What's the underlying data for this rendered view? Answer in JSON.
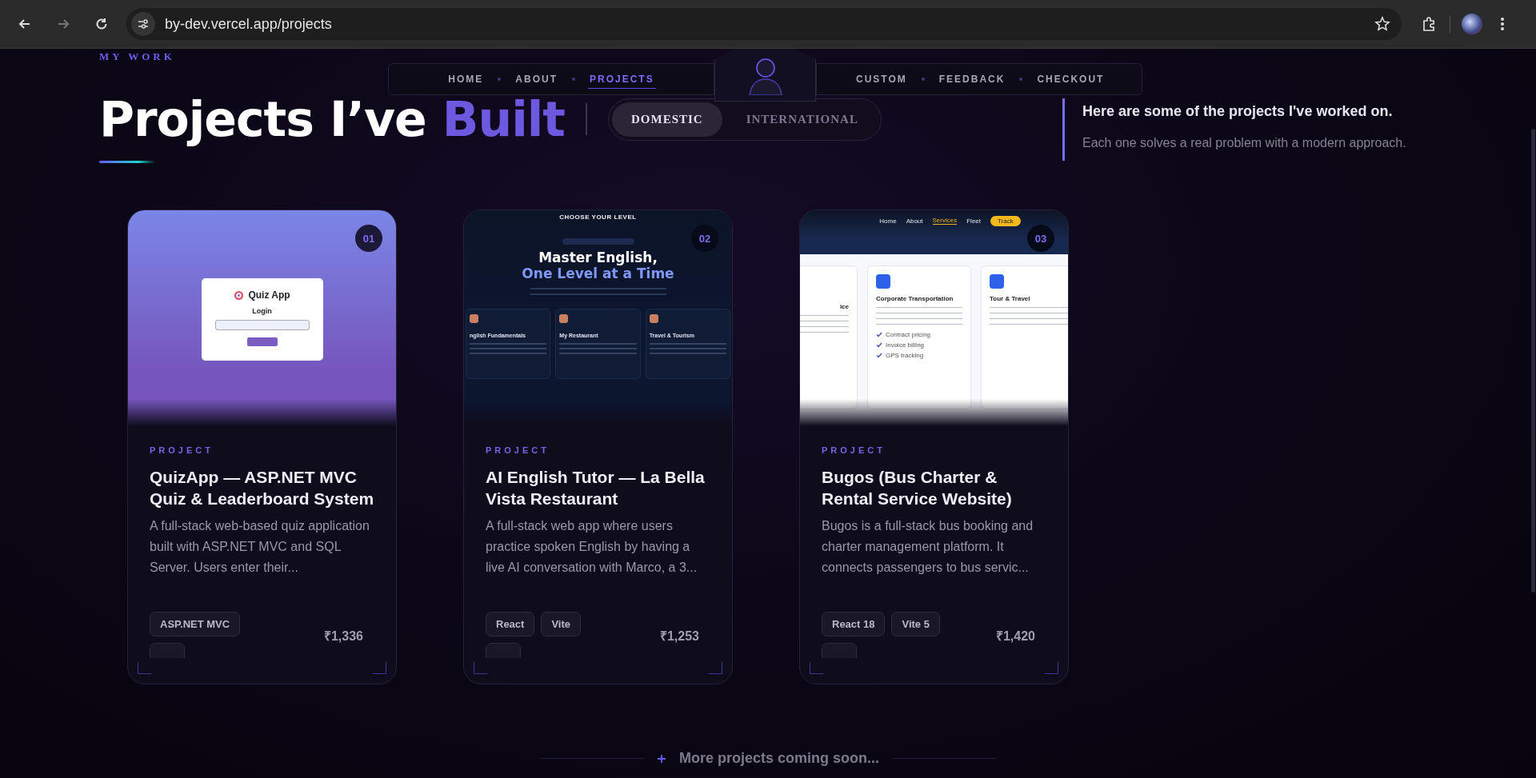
{
  "browser": {
    "url": "by-dev.vercel.app/projects",
    "nav_buttons": [
      {
        "kind": "back",
        "disabled": false
      },
      {
        "kind": "forward",
        "disabled": true
      },
      {
        "kind": "reload",
        "disabled": false
      }
    ]
  },
  "nav": {
    "left_items": [
      {
        "label": "HOME",
        "selected": false
      },
      {
        "label": "ABOUT",
        "selected": false
      },
      {
        "label": "PROJECTS",
        "selected": true
      }
    ],
    "right_items": [
      {
        "label": "CUSTOM",
        "selected": false
      },
      {
        "label": "FEEDBACK",
        "selected": false
      },
      {
        "label": "CHECKOUT",
        "selected": false
      }
    ]
  },
  "header": {
    "eyebrow": "MY WORK",
    "title": "Projects I’ve",
    "title_accent": "Built"
  },
  "filter_tabs": [
    {
      "label": "DOMESTIC",
      "selected": true
    },
    {
      "label": "INTERNATIONAL",
      "selected": false
    }
  ],
  "intro": {
    "headline": "Here are some of the projects I've worked on.",
    "subline": "Each one solves a real problem with a modern approach."
  },
  "projects": [
    {
      "number": "01",
      "category": "PROJECT",
      "title": "QuizApp — ASP.NET MVC Quiz & Leaderboard System",
      "description": "A full-stack web-based quiz application built with ASP.NET MVC and SQL Server. Users enter their...",
      "tags": [
        "ASP.NET MVC"
      ],
      "price": "₹1,336",
      "preview": {
        "kind": "quiz",
        "app_title": "Quiz App",
        "heading": "Login"
      }
    },
    {
      "number": "02",
      "category": "PROJECT",
      "title": "AI English Tutor — La Bella Vista Restaurant",
      "description": "A full-stack web app where users practice spoken English by having a live AI conversation with Marco, a 3...",
      "tags": [
        "React",
        "Vite"
      ],
      "price": "₹1,253",
      "preview": {
        "kind": "english",
        "eyebrow": "CHOOSE YOUR LEVEL",
        "headline": "Master English,",
        "headline_accent": "One Level at a Time",
        "levels": [
          "nglish Fundamentals",
          "My Restaurant",
          "Travel & Tourism"
        ]
      }
    },
    {
      "number": "03",
      "category": "PROJECT",
      "title": "Bugos (Bus Charter & Rental Service Website)",
      "description": "Bugos is a full-stack bus booking and charter management platform. It connects passengers to bus servic...",
      "tags": [
        "React 18",
        "Vite 5"
      ],
      "price": "₹1,420",
      "preview": {
        "kind": "bus",
        "links": [
          {
            "label": "Home",
            "selected": false
          },
          {
            "label": "About",
            "selected": false
          },
          {
            "label": "Services",
            "selected": true
          },
          {
            "label": "Fleet",
            "selected": false
          }
        ],
        "action": "Track",
        "services": [
          {
            "title": "ice"
          },
          {
            "title": "Corporate Transportation",
            "features": [
              "Contract pricing",
              "Invoice billing",
              "GPS tracking"
            ]
          },
          {
            "title": "Tour & Travel"
          }
        ]
      }
    }
  ],
  "footer_note": "More projects coming soon..."
}
